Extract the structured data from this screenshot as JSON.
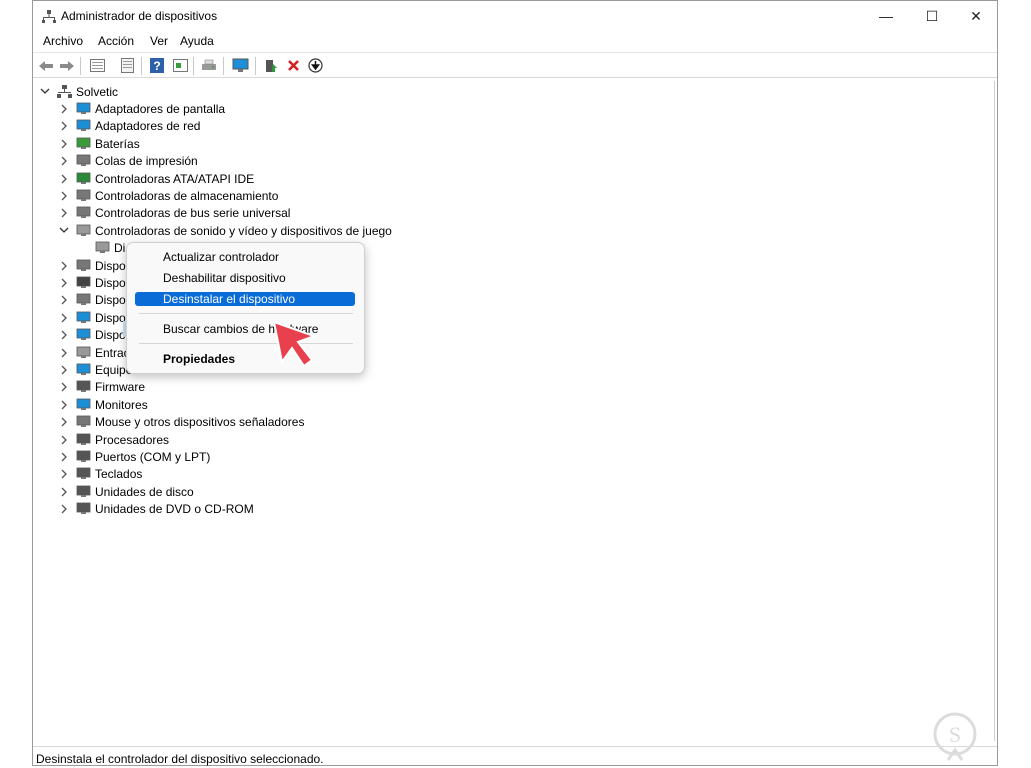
{
  "window": {
    "title": "Administrador de dispositivos",
    "minimize": "—",
    "maximize": "☐",
    "close": "✕"
  },
  "menu": [
    "Archivo",
    "Acción",
    "Ver",
    "Ayuda"
  ],
  "toolbar": [
    "back-arrow-icon",
    "forward-arrow-icon",
    "properties-grid-icon",
    "page-icon",
    "help-icon",
    "view-icon",
    "print-icon",
    "monitor-icon",
    "update-driver-icon",
    "uninstall-x-icon",
    "download-circle-icon"
  ],
  "tree": {
    "root": "Solvetic",
    "items": [
      "Adaptadores de pantalla",
      "Adaptadores de red",
      "Baterías",
      "Colas de impresión",
      "Controladoras ATA/ATAPI IDE",
      "Controladoras de almacenamiento",
      "Controladoras de bus serie universal",
      "Controladoras de sonido y vídeo y dispositivos de juego",
      "Di",
      "Dispo",
      "Dispo",
      "Dispo",
      "Dispo",
      "Dispo",
      "Entrac",
      "Equipo",
      "Firmware",
      "Monitores",
      "Mouse y otros dispositivos señaladores",
      "Procesadores",
      "Puertos (COM y LPT)",
      "Teclados",
      "Unidades de disco",
      "Unidades de DVD o CD-ROM"
    ]
  },
  "context_menu": {
    "update": "Actualizar controlador",
    "disable": "Deshabilitar dispositivo",
    "uninstall": "Desinstalar el dispositivo",
    "scan": "Buscar cambios de hardware",
    "properties": "Propiedades"
  },
  "status": "Desinstala el controlador del dispositivo seleccionado.",
  "colors": {
    "highlight": "#0a6cd6",
    "selection": "#cce4f7",
    "pointer": "#e8414d"
  }
}
